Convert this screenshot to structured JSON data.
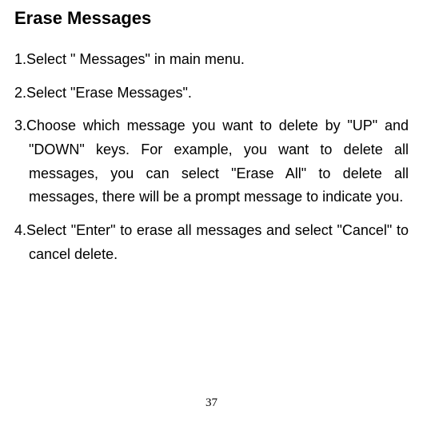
{
  "heading": "Erase Messages",
  "steps": [
    {
      "num": "1.",
      "text": "Select \" Messages\" in main menu."
    },
    {
      "num": "2.",
      "text": "Select \"Erase Messages\"."
    },
    {
      "num": "3.",
      "text": "Choose which message you want to delete by \"UP\" and \"DOWN\" keys. For example, you want to delete all messages, you can select \"Erase All\" to delete all messages, there will be a prompt message to indicate you."
    },
    {
      "num": "4.",
      "text": "Select \"Enter\" to erase all messages and select \"Cancel\" to cancel delete."
    }
  ],
  "pageNumber": "37"
}
